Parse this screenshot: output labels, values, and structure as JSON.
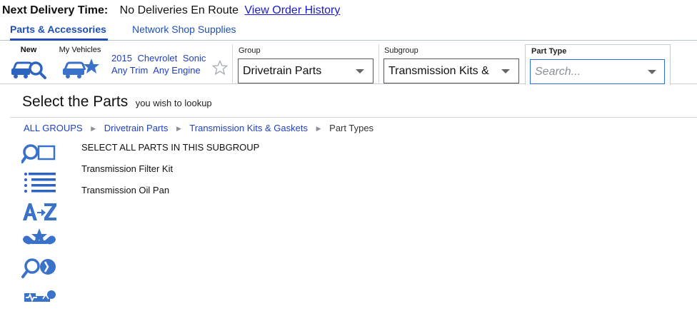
{
  "delivery": {
    "label": "Next Delivery Time:",
    "value": "No Deliveries En Route",
    "history_link": "View Order History"
  },
  "tabs": [
    {
      "label": "Parts & Accessories",
      "active": true
    },
    {
      "label": "Network Shop Supplies",
      "active": false
    }
  ],
  "vehicle_bar": {
    "new_label": "New",
    "my_vehicles_label": "My Vehicles",
    "vehicle": {
      "year": "2015",
      "make": "Chevrolet",
      "model": "Sonic",
      "trim": "Any Trim",
      "engine": "Any Engine"
    }
  },
  "selectors": {
    "group": {
      "label": "Group",
      "value": "Drivetrain Parts"
    },
    "subgroup": {
      "label": "Subgroup",
      "value": "Transmission Kits &"
    },
    "part_type": {
      "label": "Part Type",
      "placeholder": "Search..."
    }
  },
  "heading": {
    "title": "Select the Parts",
    "subtitle": "you wish to lookup"
  },
  "breadcrumb": {
    "items": [
      "ALL GROUPS",
      "Drivetrain Parts",
      "Transmission Kits & Gaskets"
    ],
    "current": "Part Types"
  },
  "parts": [
    "SELECT ALL PARTS IN THIS SUBGROUP",
    "Transmission Filter Kit",
    "Transmission Oil Pan"
  ],
  "icons": {
    "rail": [
      "search-parts-icon",
      "list-view-icon",
      "a-to-z-sort-icon",
      "favorites-tools-icon",
      "lookup-diagnostics-icon",
      "vehicle-diagnostic-icon"
    ]
  },
  "colors": {
    "link": "#1a1acf",
    "accent": "#1f4fb4",
    "icon_blue": "#3b72c9"
  }
}
